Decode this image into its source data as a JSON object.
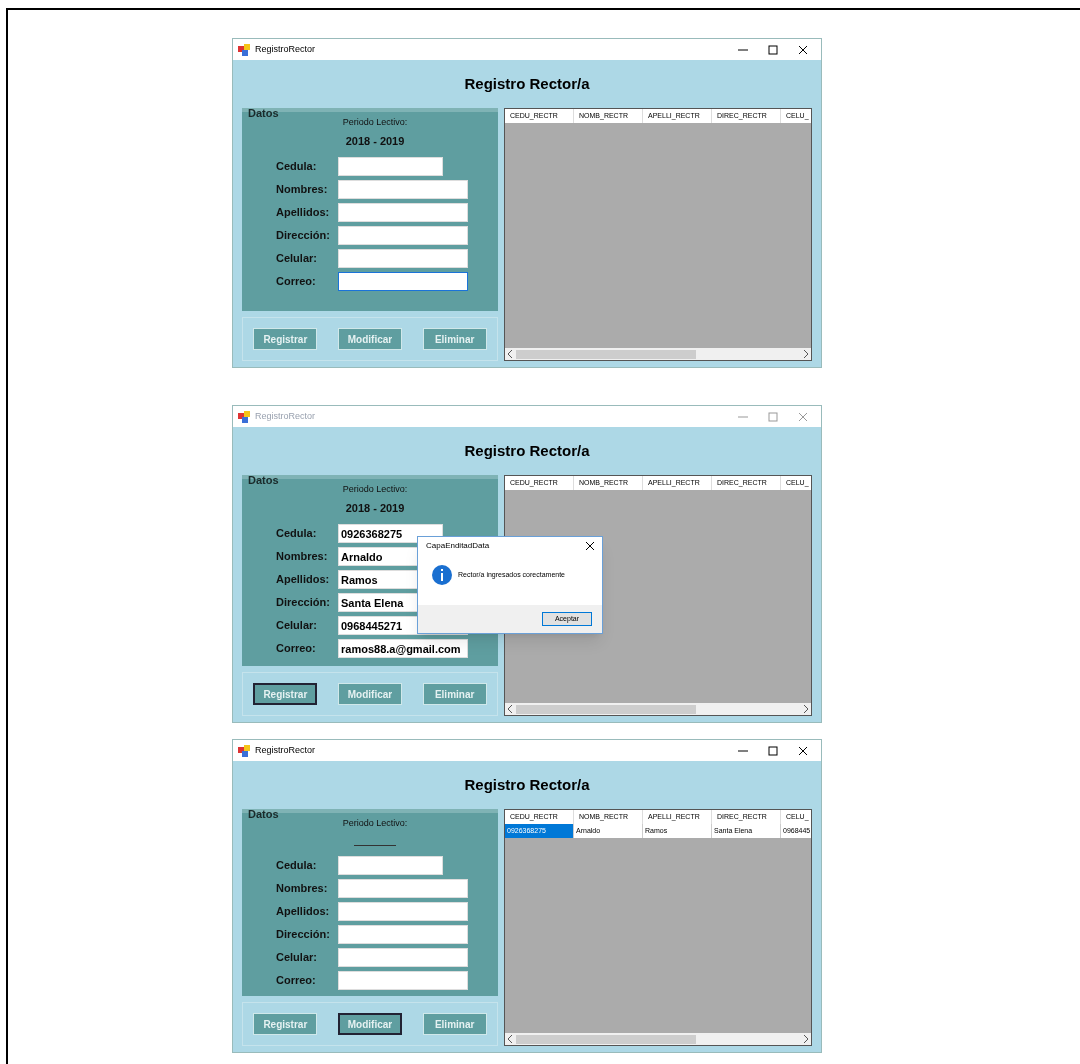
{
  "windows": [
    {
      "title": "RegistroRector",
      "active": true,
      "heading": "Registro Rector/a",
      "group_title": "Datos",
      "period_label": "Periodo Lectivo:",
      "period_value": "2018 - 2019",
      "fields": [
        {
          "label": "Cedula:",
          "focused": false,
          "short": true
        },
        {
          "label": "Nombres:",
          "focused": false,
          "short": false
        },
        {
          "label": "Apellidos:",
          "focused": false,
          "short": false
        },
        {
          "label": "Dirección:",
          "focused": false,
          "short": false
        },
        {
          "label": "Celular:",
          "focused": false,
          "short": false
        },
        {
          "label": "Correo:",
          "focused": true,
          "short": false
        }
      ],
      "buttons": [
        {
          "label": "Registrar",
          "focused": false
        },
        {
          "label": "Modificar",
          "focused": false
        },
        {
          "label": "Eliminar",
          "focused": false
        }
      ],
      "columns": [
        "CEDU_RECTR",
        "NOMB_RECTR",
        "APELLI_RECTR",
        "DIREC_RECTR",
        "CELU_"
      ]
    },
    {
      "title": "RegistroRector",
      "active": false,
      "heading": "Registro Rector/a",
      "group_title": "Datos",
      "period_label": "Periodo Lectivo:",
      "period_value": "2018 - 2019",
      "fields": [
        {
          "label": "Cedula:",
          "value": "0926368275",
          "focused": false,
          "short": true
        },
        {
          "label": "Nombres:",
          "value": "Arnaldo",
          "focused": false,
          "short": false
        },
        {
          "label": "Apellidos:",
          "value": "Ramos",
          "focused": false,
          "short": false
        },
        {
          "label": "Dirección:",
          "value": "Santa Elena",
          "focused": false,
          "short": false
        },
        {
          "label": "Celular:",
          "value": "0968445271",
          "focused": false,
          "short": false
        },
        {
          "label": "Correo:",
          "value": "ramos88.a@gmail.com",
          "focused": false,
          "short": false
        }
      ],
      "buttons": [
        {
          "label": "Registrar",
          "focused": true
        },
        {
          "label": "Modificar",
          "focused": false
        },
        {
          "label": "Eliminar",
          "focused": false
        }
      ],
      "columns": [
        "CEDU_RECTR",
        "NOMB_RECTR",
        "APELLI_RECTR",
        "DIREC_RECTR",
        "CELU_"
      ],
      "dialog": {
        "title": "CapaEnditadData",
        "message": "Rector/a ingresados corectamente",
        "button": "Aceptar"
      }
    },
    {
      "title": "RegistroRector",
      "active": true,
      "heading": "Registro Rector/a",
      "group_title": "Datos",
      "period_label": "Periodo Lectivo:",
      "fields": [
        {
          "label": "Cedula:",
          "focused": false,
          "short": true
        },
        {
          "label": "Nombres:",
          "focused": false,
          "short": false
        },
        {
          "label": "Apellidos:",
          "focused": false,
          "short": false
        },
        {
          "label": "Dirección:",
          "focused": false,
          "short": false
        },
        {
          "label": "Celular:",
          "focused": false,
          "short": false
        },
        {
          "label": "Correo:",
          "focused": false,
          "short": false
        }
      ],
      "buttons": [
        {
          "label": "Registrar",
          "focused": false
        },
        {
          "label": "Modificar",
          "focused": true
        },
        {
          "label": "Eliminar",
          "focused": false
        }
      ],
      "columns": [
        "CEDU_RECTR",
        "NOMB_RECTR",
        "APELLI_RECTR",
        "DIREC_RECTR",
        "CELU_"
      ],
      "rows": [
        [
          {
            "text": "0926368275",
            "selected": true
          },
          {
            "text": "Arnaldo",
            "selected": false
          },
          {
            "text": "Ramos",
            "selected": false
          },
          {
            "text": "Santa Elena",
            "selected": false
          },
          {
            "text": "0968445",
            "selected": false
          }
        ]
      ]
    }
  ]
}
